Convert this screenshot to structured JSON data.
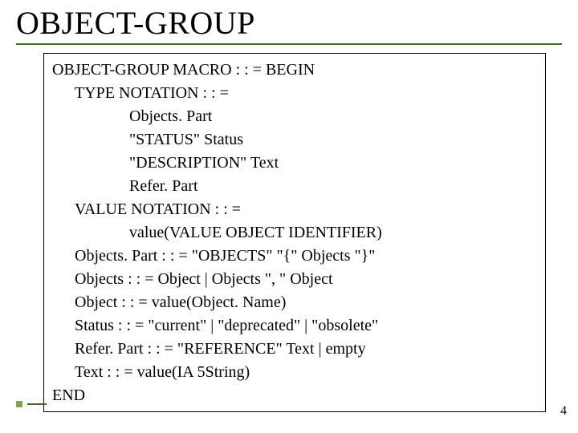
{
  "title": "OBJECT-GROUP",
  "page_number": "4",
  "lines": [
    {
      "indent": 0,
      "text": "OBJECT-GROUP MACRO : : = BEGIN"
    },
    {
      "indent": 1,
      "text": "TYPE NOTATION : : ="
    },
    {
      "indent": 2,
      "text": "Objects. Part"
    },
    {
      "indent": 2,
      "text": "\"STATUS\" Status"
    },
    {
      "indent": 2,
      "text": "\"DESCRIPTION\" Text"
    },
    {
      "indent": 2,
      "text": "Refer. Part"
    },
    {
      "indent": 1,
      "text": "VALUE NOTATION : : ="
    },
    {
      "indent": 2,
      "text": "value(VALUE OBJECT IDENTIFIER)"
    },
    {
      "indent": 1,
      "text": "Objects. Part : : = \"OBJECTS\" \"{\" Objects \"}\""
    },
    {
      "indent": 1,
      "text": "Objects : : = Object | Objects \", \" Object"
    },
    {
      "indent": 1,
      "text": "Object : : = value(Object. Name)"
    },
    {
      "indent": 1,
      "text": "Status : : = \"current\" | \"deprecated\" | \"obsolete\""
    },
    {
      "indent": 1,
      "text": "Refer. Part : : = \"REFERENCE\" Text | empty"
    },
    {
      "indent": 1,
      "text": "Text : : = value(IA 5String)"
    },
    {
      "indent": 0,
      "text": "END"
    }
  ]
}
